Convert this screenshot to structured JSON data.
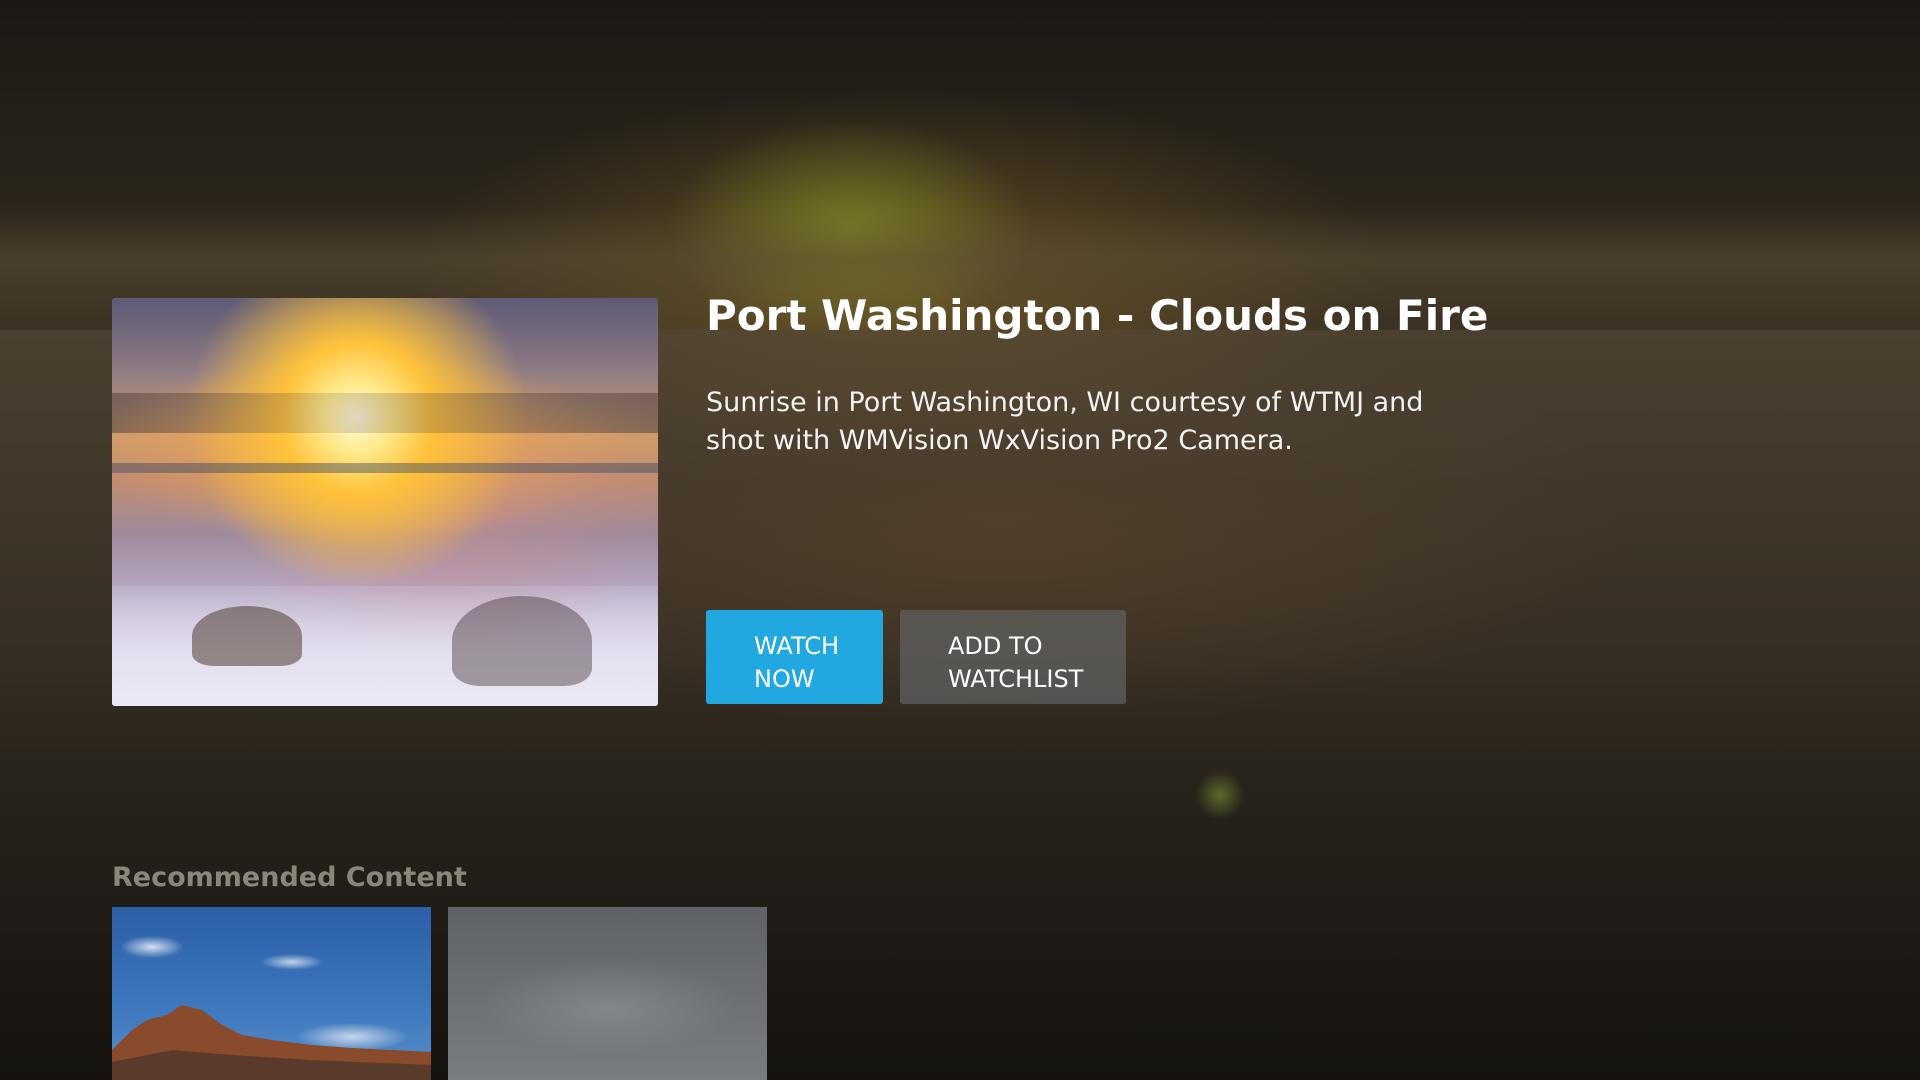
{
  "hero": {
    "title": "Port Washington - Clouds on Fire",
    "description": "Sunrise in Port Washington, WI courtesy of WTMJ and shot with WMVision WxVision Pro2 Camera.",
    "thumbnail_alt": "Sunrise over Port Washington harbor"
  },
  "actions": {
    "watch_now_label": "WATCH\nNOW",
    "add_to_watchlist_label": "ADD TO\nWATCHLIST"
  },
  "recommended": {
    "heading": "Recommended Content",
    "items": [
      {
        "alt": "Red rock mountains under blue sky"
      },
      {
        "alt": "Overcast grey sky"
      }
    ]
  },
  "colors": {
    "accent": "#21a8e0",
    "secondary_button": "#5f5f5f",
    "heading_muted": "#8b8679"
  }
}
